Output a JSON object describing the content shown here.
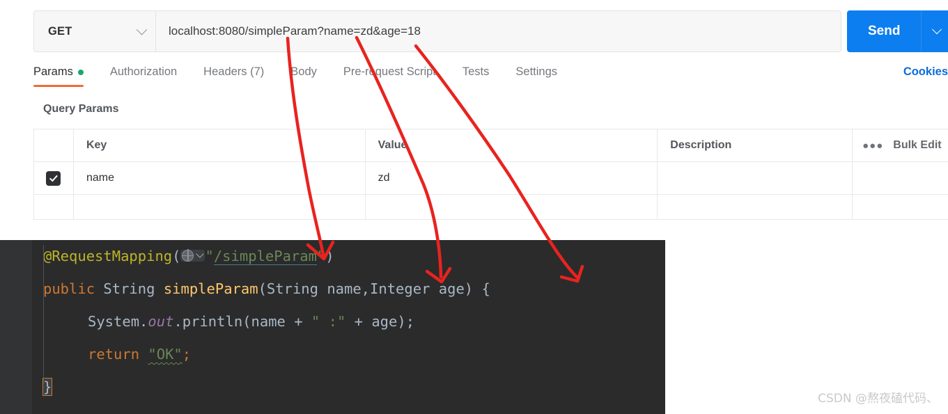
{
  "request": {
    "method": "GET",
    "url": "localhost:8080/simpleParam?name=zd&age=18",
    "send_label": "Send",
    "cookies_label": "Cookies",
    "method_chevron_icon": "chevron-down-icon",
    "send_chevron_icon": "chevron-down-icon"
  },
  "tabs": [
    {
      "label": "Params",
      "active": true,
      "dot": true
    },
    {
      "label": "Authorization",
      "active": false,
      "dot": false
    },
    {
      "label": "Headers (7)",
      "active": false,
      "dot": false
    },
    {
      "label": "Body",
      "active": false,
      "dot": false
    },
    {
      "label": "Pre-request Script",
      "active": false,
      "dot": false
    },
    {
      "label": "Tests",
      "active": false,
      "dot": false
    },
    {
      "label": "Settings",
      "active": false,
      "dot": false
    }
  ],
  "params": {
    "section_title": "Query Params",
    "columns": {
      "key": "Key",
      "value": "Value",
      "description": "Description"
    },
    "more_options_icon": "ellipsis-icon",
    "bulk_edit_label": "Bulk Edit",
    "rows": [
      {
        "checked": true,
        "key": "name",
        "value": "zd",
        "description": ""
      }
    ]
  },
  "code": {
    "line1": {
      "annotation": "@RequestMapping",
      "open_paren": "(",
      "gutter_icon": "globe-endpoint-icon",
      "quote_open": "\"",
      "path": "/simpleParam",
      "quote_close": "\"",
      "close_paren": ")"
    },
    "line2": {
      "modifier": "public",
      "return_type": "String",
      "method_name": "simpleParam",
      "signature": "(String name,Integer age) {"
    },
    "line3": {
      "prefix": "System.",
      "field": "out",
      "suffix_a": ".println(name + ",
      "string": "\" :\"",
      "suffix_b": " + age);"
    },
    "line4": {
      "keyword": "return",
      "string": "\"OK\"",
      "semicolon": ";"
    },
    "line5": {
      "brace": "}"
    }
  },
  "watermark": "CSDN @熬夜磕代码、",
  "colors": {
    "send_blue": "#0d7ef0",
    "cookies_blue": "#0b6bdb",
    "tab_underline_orange": "#f06a33",
    "params_dot_green": "#19a86b",
    "editor_background": "#2b2b2b",
    "annotation_red": "#e8231f"
  }
}
